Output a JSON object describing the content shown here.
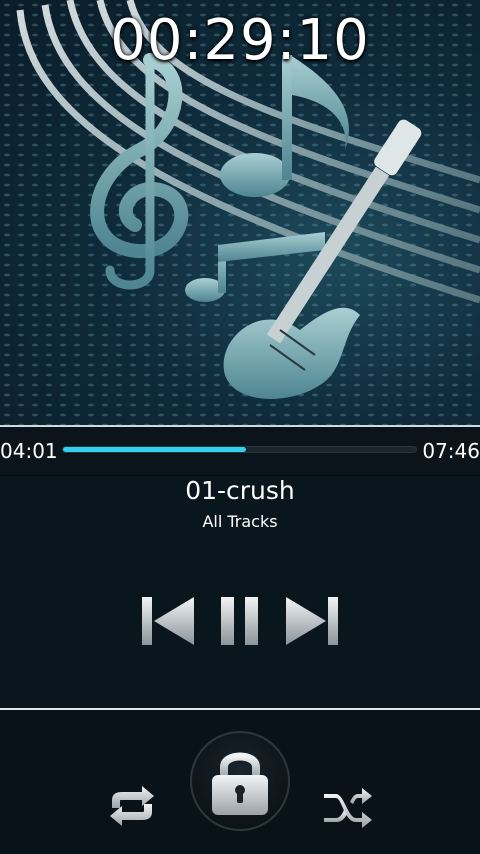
{
  "header": {
    "clock": "00:29:10"
  },
  "player": {
    "elapsed": "04:01",
    "duration": "07:46",
    "progress_fraction": 0.518,
    "song_title": "01-crush",
    "album": "All Tracks"
  },
  "icons": {
    "previous": "previous-track-icon",
    "pause": "pause-icon",
    "next": "next-track-icon",
    "repeat": "repeat-icon",
    "lock": "lock-icon",
    "shuffle": "shuffle-icon"
  },
  "colors": {
    "accent": "#33d0ee",
    "background": "#071019"
  }
}
